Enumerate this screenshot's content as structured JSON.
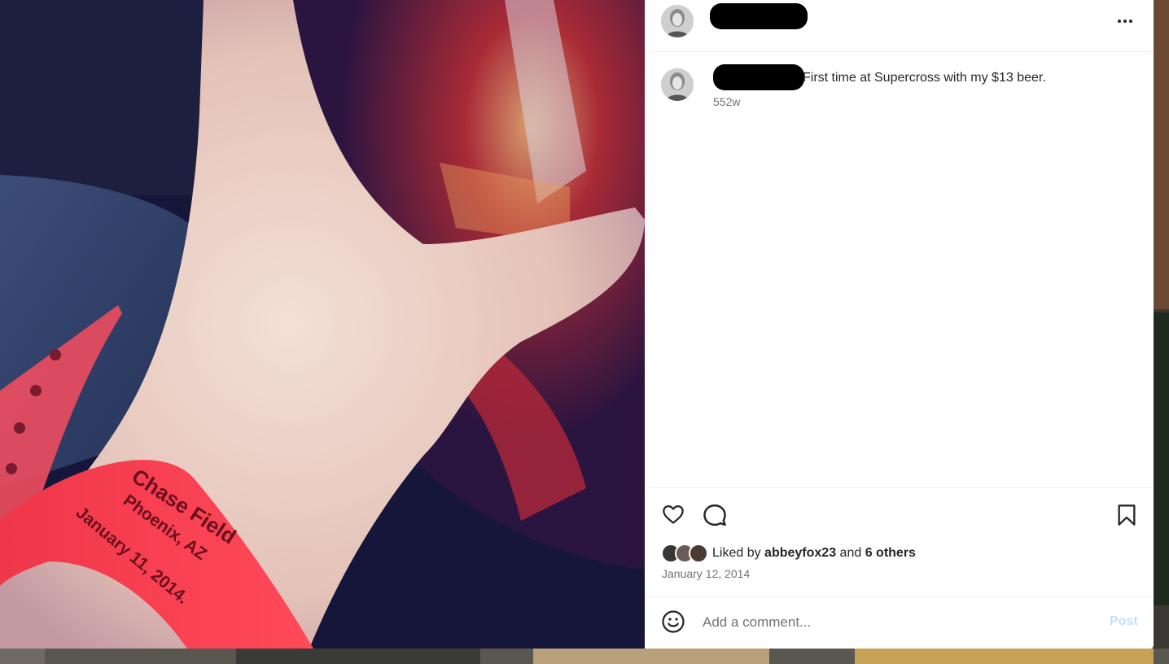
{
  "post": {
    "caption": "First time at Supercross with my $13 beer.",
    "time_ago": "552w",
    "liked_by_prefix": "Liked by",
    "liked_by_user": "abbeyfox23",
    "liked_by_and": "and",
    "liked_by_others": "6 others",
    "date": "January 12, 2014"
  },
  "photo": {
    "wristband_line1": "Chase Field",
    "wristband_line2": "Phoenix, AZ",
    "wristband_line3": "January 11, 2014."
  },
  "comment": {
    "placeholder": "Add a comment...",
    "post_label": "Post"
  },
  "icons": {
    "more": "more-horizontal-icon",
    "like": "heart-icon",
    "comment": "comment-bubble-icon",
    "save": "bookmark-icon",
    "emoji": "smiley-icon"
  },
  "colors": {
    "post_button_disabled": "#c0dffd",
    "secondary_text": "#737373",
    "primary_text": "#262626"
  }
}
